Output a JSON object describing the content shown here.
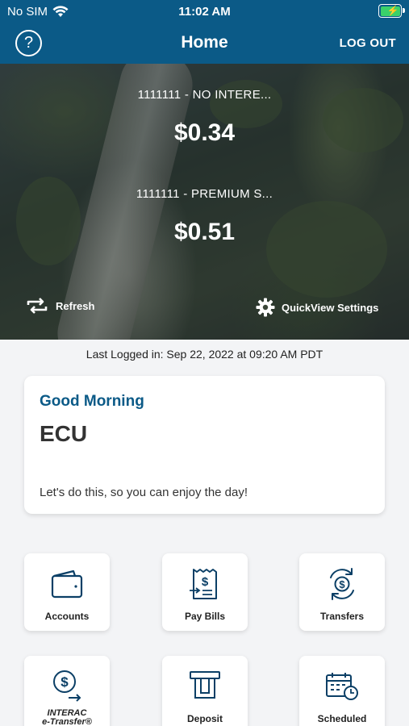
{
  "status": {
    "carrier": "No SIM",
    "time": "11:02 AM"
  },
  "nav": {
    "help": "?",
    "title": "Home",
    "logout": "LOG OUT"
  },
  "accounts": [
    {
      "name": "1111111 - NO INTERE...",
      "balance": "$0.34"
    },
    {
      "name": "1111111 - PREMIUM S...",
      "balance": "$0.51"
    }
  ],
  "hero_actions": {
    "refresh": "Refresh",
    "quickview": "QuickView Settings"
  },
  "last_logged": "Last Logged in: Sep 22, 2022 at 09:20 AM  PDT",
  "greeting": {
    "salutation": "Good Morning",
    "name": "ECU",
    "message": "Let's do this, so you can enjoy the day!"
  },
  "tiles": {
    "accounts": "Accounts",
    "pay_bills": "Pay Bills",
    "transfers": "Transfers",
    "interac_line1": "INTERAC",
    "interac_line2": "e-Transfer®",
    "deposit": "Deposit",
    "scheduled": "Scheduled"
  },
  "colors": {
    "nav": "#0b5a87",
    "accent": "#0b5a87",
    "battery": "#3ad16a"
  }
}
